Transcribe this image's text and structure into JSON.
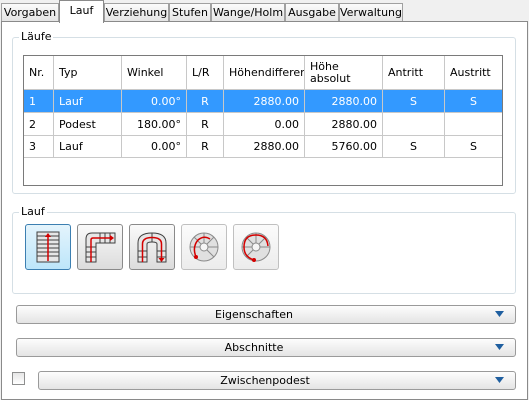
{
  "tabs": [
    "Vorgaben",
    "Lauf",
    "Verziehung",
    "Stufen",
    "Wange/Holm",
    "Ausgabe",
    "Verwaltung"
  ],
  "active_tab": "Lauf",
  "laeufe": {
    "group_title": "Läufe",
    "columns": [
      "Nr.",
      "Typ",
      "Winkel",
      "L/R",
      "Höhendifferenz",
      "Höhe absolut",
      "Antritt",
      "Austritt"
    ],
    "rows": [
      {
        "nr": "1",
        "typ": "Lauf",
        "winkel": "0.00°",
        "lr": "R",
        "hdiff": "2880.00",
        "habs": "2880.00",
        "antritt": "S",
        "austritt": "S",
        "selected": true
      },
      {
        "nr": "2",
        "typ": "Podest",
        "winkel": "180.00°",
        "lr": "R",
        "hdiff": "0.00",
        "habs": "2880.00",
        "antritt": "",
        "austritt": "",
        "selected": false
      },
      {
        "nr": "3",
        "typ": "Lauf",
        "winkel": "0.00°",
        "lr": "R",
        "hdiff": "2880.00",
        "habs": "5760.00",
        "antritt": "S",
        "austritt": "S",
        "selected": false
      }
    ]
  },
  "lauf": {
    "group_title": "Lauf",
    "buttons": [
      {
        "icon": "straight-run-icon",
        "state": "active"
      },
      {
        "icon": "quarter-turn-icon",
        "state": "normal"
      },
      {
        "icon": "u-turn-icon",
        "state": "normal"
      },
      {
        "icon": "spiral-icon",
        "state": "disabled"
      },
      {
        "icon": "spiral-full-icon",
        "state": "disabled"
      }
    ]
  },
  "sections": {
    "eigenschaften": "Eigenschaften",
    "abschnitte": "Abschnitte",
    "zwischenpodest": "Zwischenpodest"
  },
  "zwischenpodest_checked": false,
  "colors": {
    "selection": "#3399ff",
    "accent": "#3c7fb1",
    "stair_red": "#d40000"
  }
}
